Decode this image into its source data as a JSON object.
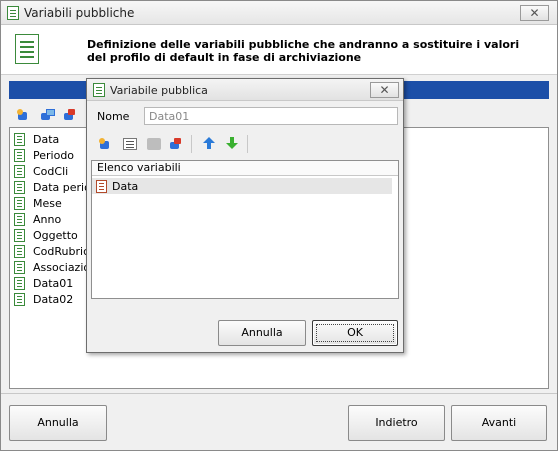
{
  "outer_window": {
    "title": "Variabili pubbliche",
    "close_label": "✕",
    "header_text": "Definizione delle variabili pubbliche che andranno a sostituire i valori\ndel profilo di default in fase di archiviazione",
    "items": [
      "Data",
      "Periodo",
      "CodCli",
      "Data period",
      "Mese",
      "Anno",
      "Oggetto",
      "CodRubrica",
      "Associazion",
      "Data01",
      "Data02"
    ],
    "buttons": {
      "cancel": "Annulla",
      "back": "Indietro",
      "next": "Avanti"
    }
  },
  "dialog": {
    "title": "Variabile pubblica",
    "close_label": "✕",
    "name_label": "Nome",
    "name_value": "Data01",
    "list_header": "Elenco variabili",
    "list_items": [
      "Data"
    ],
    "buttons": {
      "cancel": "Annulla",
      "ok": "OK"
    }
  },
  "colors": {
    "title_blue_bar": "#1c4fa8",
    "icon_green": "#3b8a3b"
  }
}
